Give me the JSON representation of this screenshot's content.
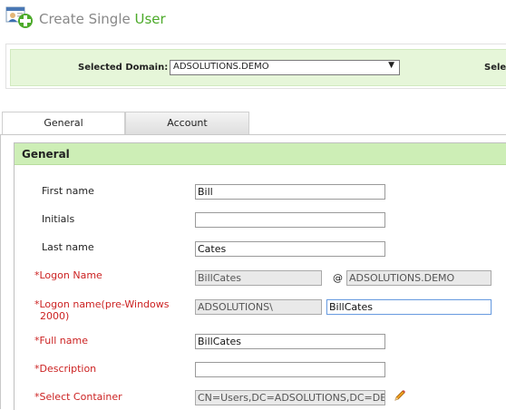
{
  "header": {
    "title_prefix": "Create Single ",
    "title_highlight": "User",
    "icon": "add-user-icon"
  },
  "domain": {
    "label": "Selected Domain:",
    "selected": "ADSOLUTIONS.DEMO",
    "right_label": "Sele"
  },
  "tabs": [
    {
      "label": "General",
      "active": true
    },
    {
      "label": "Account",
      "active": false
    }
  ],
  "section": {
    "title": "General"
  },
  "fields": {
    "first_name": {
      "label": "First name",
      "value": "Bill"
    },
    "initials": {
      "label": "Initials",
      "value": ""
    },
    "last_name": {
      "label": "Last name",
      "value": "Cates"
    },
    "logon_name": {
      "label": "Logon Name",
      "required_mark": "*",
      "value": "BillCates",
      "at": "@",
      "domain": "ADSOLUTIONS.DEMO"
    },
    "logon_pre2000": {
      "label_line1": "Logon name(pre-Windows",
      "label_line2": "2000)",
      "required_mark": "*",
      "prefix": "ADSOLUTIONS\\",
      "value": "BillCates"
    },
    "full_name": {
      "label": "Full name",
      "required_mark": "*",
      "value": "BillCates"
    },
    "description": {
      "label": "Description",
      "required_mark": "*",
      "value": ""
    },
    "select_container": {
      "label": "Select Container",
      "required_mark": "*",
      "value": "CN=Users,DC=ADSOLUTIONS,DC=DEMO",
      "icon": "pencil-icon"
    }
  },
  "colors": {
    "accent_green": "#4caa2a",
    "required_red": "#cc2222",
    "section_bg": "#cdeeb6",
    "domain_bg": "#e6f6d9"
  }
}
